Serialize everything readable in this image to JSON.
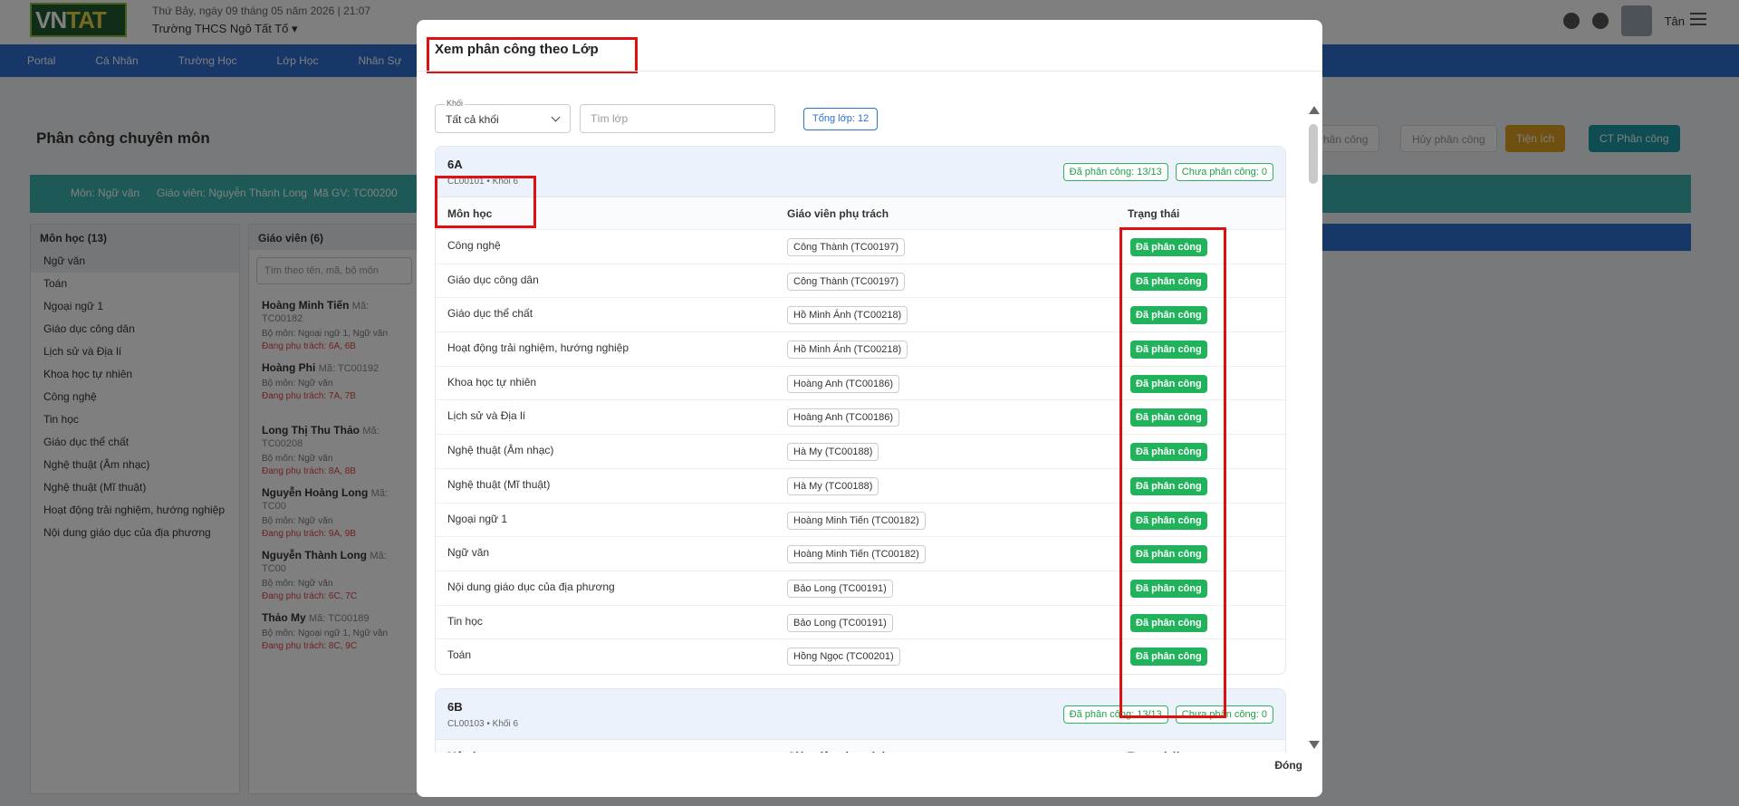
{
  "app": {
    "logo": "VNTAT",
    "date": "Thứ Bảy, ngày 09 tháng 05 năm 2026 | 21:07",
    "school": "Trường THCS Ngô Tất Tố",
    "user": "Tân",
    "nav": [
      "Portal",
      "Cá Nhân",
      "Trường Học",
      "Lớp Học",
      "Nhân Sự"
    ],
    "page_title": "Phân công chuyên môn",
    "buttons": [
      "Phân công",
      "Hủy phân công",
      "Tiện ích",
      "CT Phân công"
    ],
    "info": {
      "subject": "Môn: Ngữ văn",
      "teacher": "Giáo viên: Nguyễn Thành Long",
      "code": "Mã GV: TC00200"
    },
    "subjects_panel": {
      "title": "Môn học (13)",
      "items": [
        "Ngữ văn",
        "Toán",
        "Ngoại ngữ 1",
        "Giáo dục công dân",
        "Lịch sử và Địa lí",
        "Khoa học tự nhiên",
        "Công nghệ",
        "Tin học",
        "Giáo dục thể chất",
        "Nghệ thuật (Âm nhạc)",
        "Nghệ thuật (Mĩ thuật)",
        "Hoạt động trải nghiệm, hướng nghiệp",
        "Nội dung giáo dục của địa phương"
      ]
    },
    "teachers_panel": {
      "title": "Giáo viên (6)",
      "search_placeholder": "Tìm theo tên, mã, bộ môn",
      "items": [
        {
          "name": "Hoàng Minh Tiến",
          "code": "Mã: TC00182",
          "dept": "Bộ môn: Ngoại ngữ 1, Ngữ văn",
          "assigned": "Đang phụ trách: 6A, 6B"
        },
        {
          "name": "Hoàng Phi",
          "code": "Mã: TC00192",
          "dept": "Bộ môn: Ngữ văn",
          "assigned": "Đang phụ trách: 7A, 7B"
        },
        {
          "name": "Long Thị Thu Thảo",
          "code": "Mã: TC00208",
          "dept": "Bộ môn: Ngữ văn",
          "assigned": "Đang phụ trách: 8A, 8B"
        },
        {
          "name": "Nguyễn Hoàng Long",
          "code": "Mã: TC00",
          "dept": "Bộ môn: Ngữ văn",
          "assigned": "Đang phụ trách: 9A, 9B"
        },
        {
          "name": "Nguyễn Thành Long",
          "code": "Mã: TC00",
          "dept": "Bộ môn: Ngữ văn",
          "assigned": "Đang phụ trách: 6C, 7C"
        },
        {
          "name": "Thảo My",
          "code": "Mã: TC00189",
          "dept": "Bộ môn: Ngoại ngữ 1, Ngữ văn",
          "assigned": "Đang phụ trách: 8C, 9C"
        }
      ]
    }
  },
  "modal": {
    "title": "Xem phân công theo Lớp",
    "filter": {
      "grade_label": "Khối",
      "grade_value": "Tất cả khối",
      "search_placeholder": "Tìm lớp",
      "total": "Tổng lớp: 12"
    },
    "columns": {
      "subject": "Môn học",
      "teacher": "Giáo viên phụ trách",
      "status": "Trạng thái"
    },
    "classes": [
      {
        "name": "6A",
        "code": "CL00101 • Khối 6",
        "assigned_badge": "Đã phân công: 13/13",
        "unassigned_badge": "Chưa phân công: 0",
        "rows": [
          {
            "subject": "Công nghệ",
            "teacher": "Công Thành (TC00197)",
            "status": "Đã phân công"
          },
          {
            "subject": "Giáo dục công dân",
            "teacher": "Công Thành (TC00197)",
            "status": "Đã phân công"
          },
          {
            "subject": "Giáo dục thể chất",
            "teacher": "Hồ Minh Ánh (TC00218)",
            "status": "Đã phân công"
          },
          {
            "subject": "Hoạt động trải nghiệm, hướng nghiệp",
            "teacher": "Hồ Minh Ánh (TC00218)",
            "status": "Đã phân công"
          },
          {
            "subject": "Khoa học tự nhiên",
            "teacher": "Hoàng Anh (TC00186)",
            "status": "Đã phân công"
          },
          {
            "subject": "Lịch sử và Địa lí",
            "teacher": "Hoàng Anh (TC00186)",
            "status": "Đã phân công"
          },
          {
            "subject": "Nghệ thuật (Âm nhạc)",
            "teacher": "Hà My (TC00188)",
            "status": "Đã phân công"
          },
          {
            "subject": "Nghệ thuật (Mĩ thuật)",
            "teacher": "Hà My (TC00188)",
            "status": "Đã phân công"
          },
          {
            "subject": "Ngoại ngữ 1",
            "teacher": "Hoàng Minh Tiến (TC00182)",
            "status": "Đã phân công"
          },
          {
            "subject": "Ngữ văn",
            "teacher": "Hoàng Minh Tiến (TC00182)",
            "status": "Đã phân công"
          },
          {
            "subject": "Nội dung giáo dục của địa phương",
            "teacher": "Bảo Long (TC00191)",
            "status": "Đã phân công"
          },
          {
            "subject": "Tin học",
            "teacher": "Bảo Long (TC00191)",
            "status": "Đã phân công"
          },
          {
            "subject": "Toán",
            "teacher": "Hồng Ngọc (TC00201)",
            "status": "Đã phân công"
          }
        ]
      },
      {
        "name": "6B",
        "code": "CL00103 • Khối 6",
        "assigned_badge": "Đã phân công: 13/13",
        "unassigned_badge": "Chưa phân công: 0",
        "rows": []
      }
    ],
    "close_label": "Đóng"
  }
}
